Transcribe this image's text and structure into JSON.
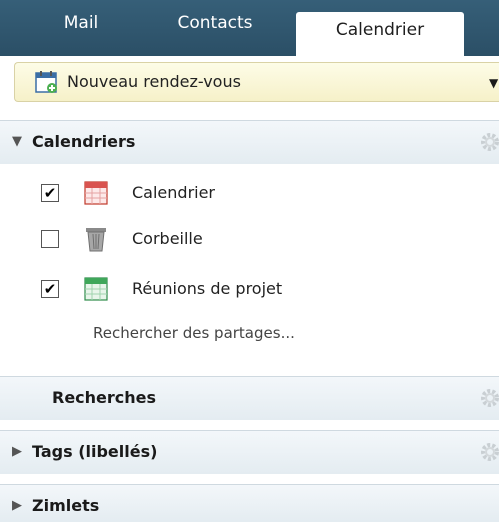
{
  "tabs": [
    {
      "label": "Mail",
      "active": false
    },
    {
      "label": "Contacts",
      "active": false
    },
    {
      "label": "Calendrier",
      "active": true
    }
  ],
  "new_appointment": {
    "label": "Nouveau rendez-vous",
    "icon": "calendar-add-icon"
  },
  "sections": {
    "calendars": {
      "title": "Calendriers",
      "expanded": true,
      "items": [
        {
          "label": "Calendrier",
          "checked": true,
          "icon": "calendar-red-icon",
          "color": "#d9534f"
        },
        {
          "label": "Corbeille",
          "checked": false,
          "icon": "trash-icon"
        },
        {
          "label": "Réunions de projet",
          "checked": true,
          "icon": "calendar-green-icon",
          "color": "#3fa75a"
        }
      ],
      "search_link": "Rechercher des partages..."
    },
    "searches": {
      "title": "Recherches"
    },
    "tags": {
      "title": "Tags (libellés)",
      "expanded": false
    },
    "zimlets": {
      "title": "Zimlets",
      "expanded": false
    }
  },
  "colors": {
    "topbar": "#365f78",
    "new_button_bg": "#f8f4d6",
    "section_bg": "#e8eff4"
  }
}
